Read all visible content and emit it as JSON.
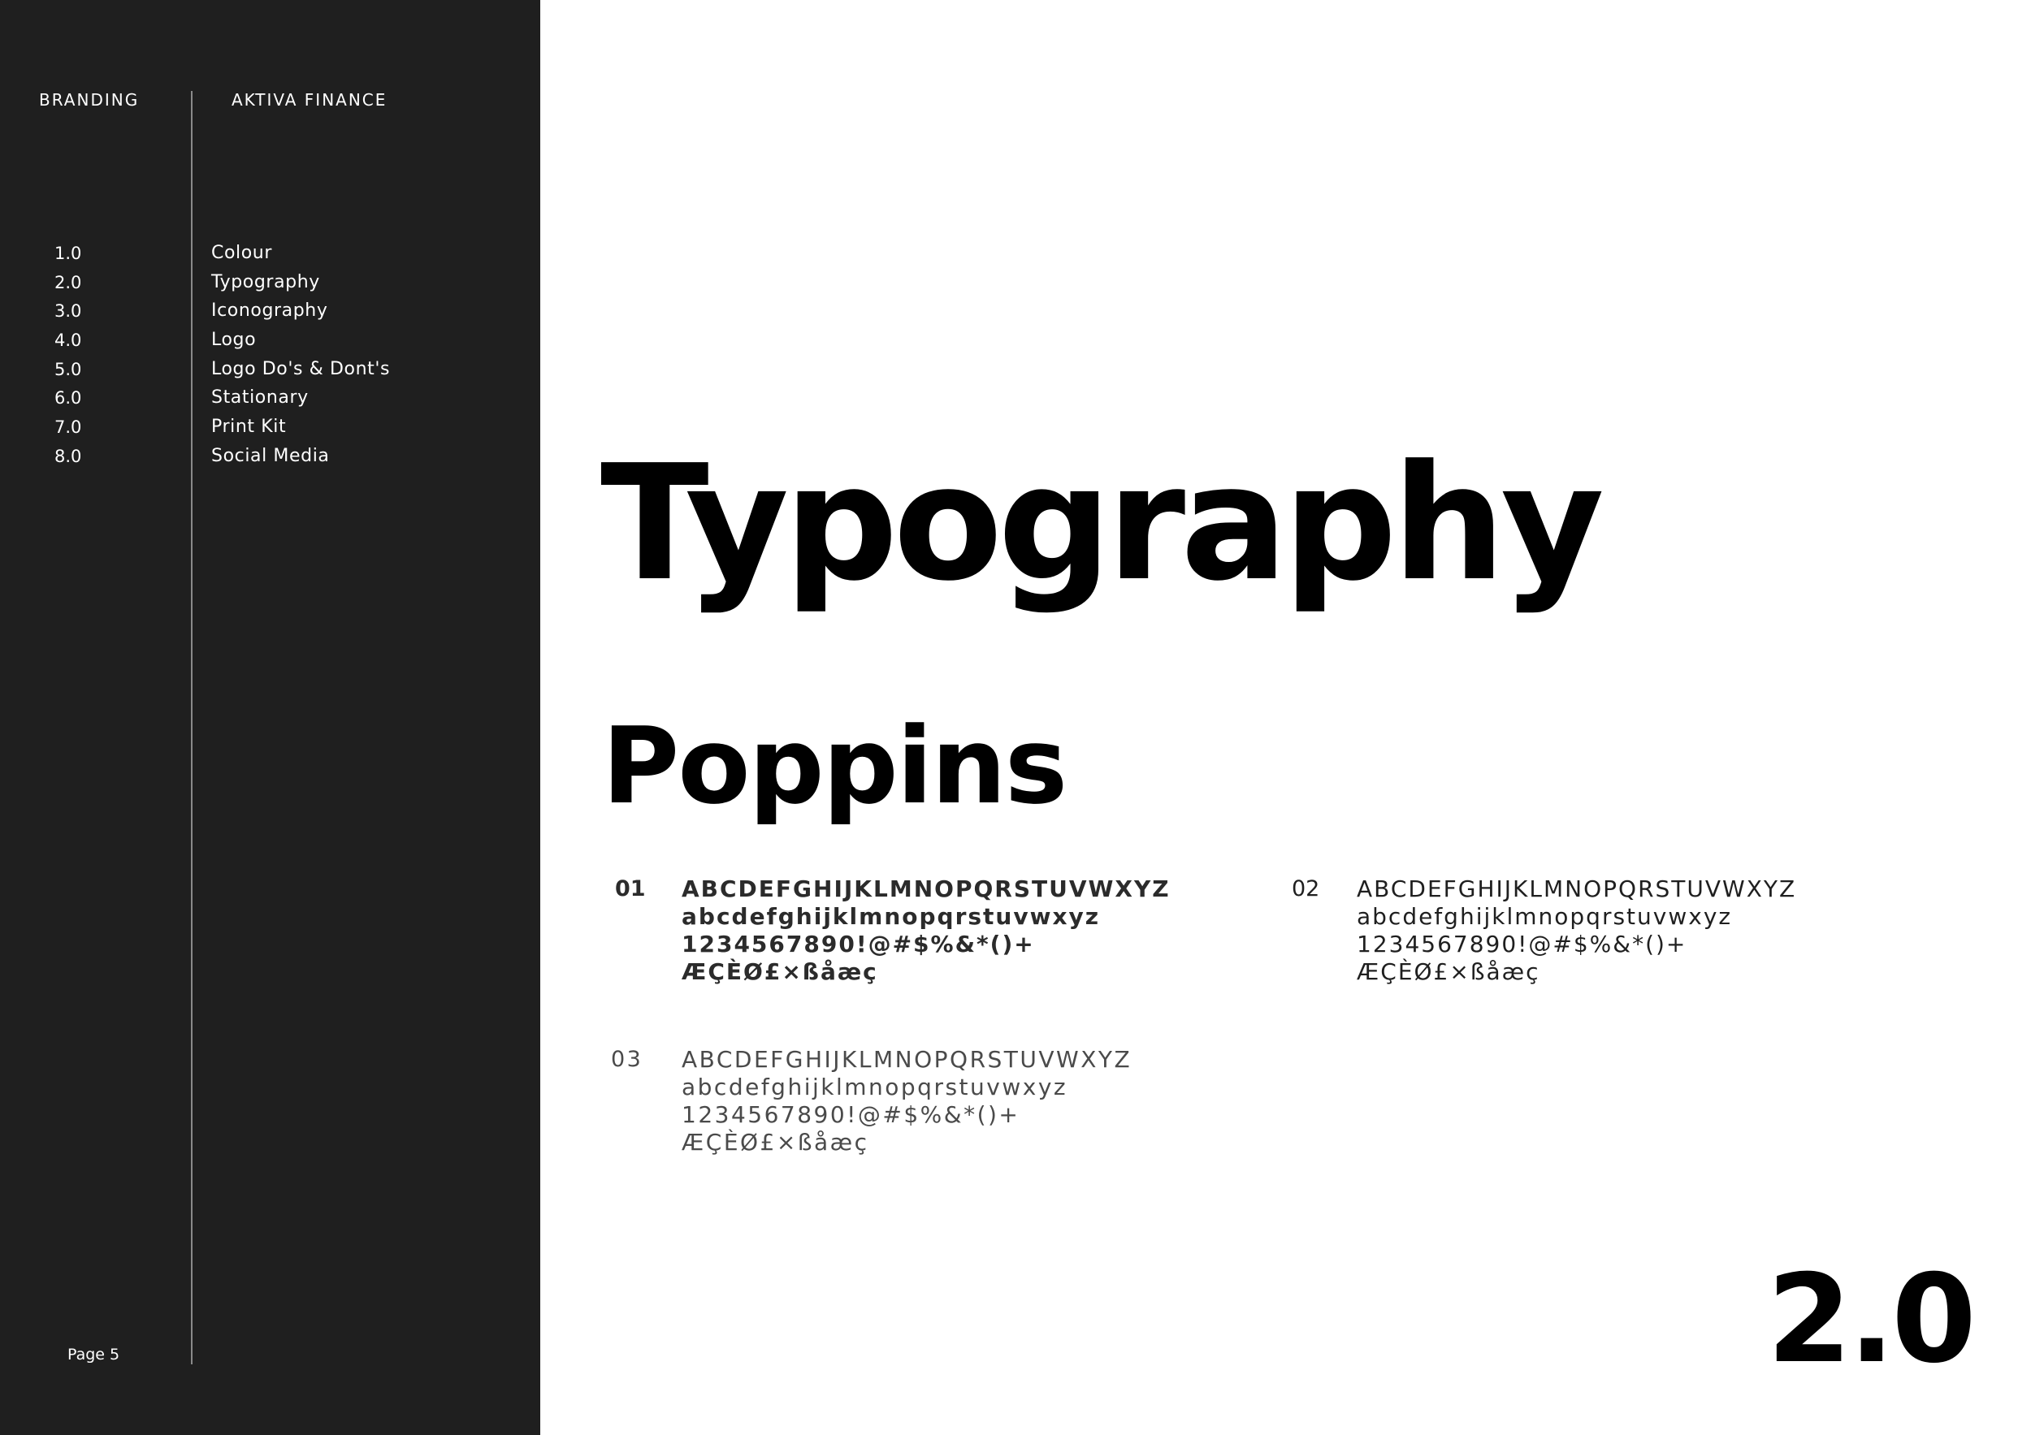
{
  "header": {
    "section": "BRANDING",
    "company": "AKTIVA FINANCE"
  },
  "nav": {
    "items": [
      {
        "number": "1.0",
        "label": "Colour"
      },
      {
        "number": "2.0",
        "label": "Typography"
      },
      {
        "number": "3.0",
        "label": "Iconography"
      },
      {
        "number": "4.0",
        "label": "Logo"
      },
      {
        "number": "5.0",
        "label": "Logo Do's & Dont's"
      },
      {
        "number": "6.0",
        "label": "Stationary"
      },
      {
        "number": "7.0",
        "label": "Print Kit"
      },
      {
        "number": "8.0",
        "label": "Social Media"
      }
    ]
  },
  "footer": {
    "page": "Page 5"
  },
  "main": {
    "title": "Typography",
    "font_name": "Poppins",
    "section_number": "2.0",
    "samples": [
      {
        "id": "01",
        "lines": [
          "ABCDEFGHIJKLMNOPQRSTUVWXYZ",
          "abcdefghijklmnopqrstuvwxyz",
          "1234567890!@#$%&*()+",
          "ÆÇÈØ£×ßåæç"
        ]
      },
      {
        "id": "02",
        "lines": [
          "ABCDEFGHIJKLMNOPQRSTUVWXYZ",
          "abcdefghijklmnopqrstuvwxyz",
          "1234567890!@#$%&*()+",
          "ÆÇÈØ£×ßåæç"
        ]
      },
      {
        "id": "03",
        "lines": [
          "ABCDEFGHIJKLMNOPQRSTUVWXYZ",
          "abcdefghijklmnopqrstuvwxyz",
          "1234567890!@#$%&*()+",
          "ÆÇÈØ£×ßåæç"
        ]
      }
    ]
  },
  "colors": {
    "sidebar_bg": "#1f1f1f",
    "page_bg": "#ffffff",
    "text_dark": "#000000"
  }
}
